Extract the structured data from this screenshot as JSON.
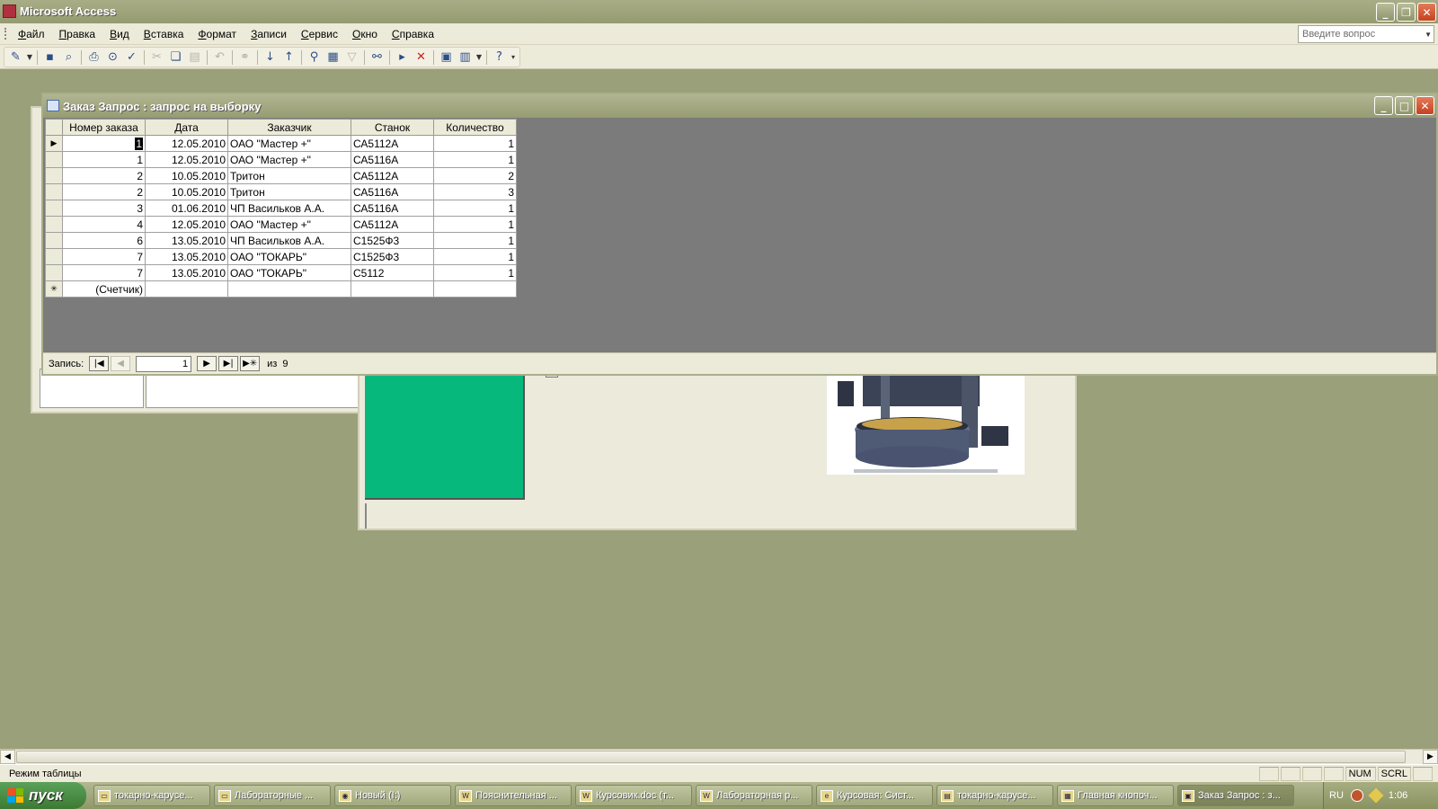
{
  "app": {
    "title": "Microsoft Access"
  },
  "menu": {
    "items": [
      "Файл",
      "Правка",
      "Вид",
      "Вставка",
      "Формат",
      "Записи",
      "Сервис",
      "Окно",
      "Справка"
    ],
    "ask_placeholder": "Введите вопрос"
  },
  "toolbar": {
    "icons": [
      "view-design-icon",
      "dropdown-arrow-icon",
      "save-icon",
      "search-file-icon",
      "print-icon",
      "print-preview-icon",
      "spelling-icon",
      "cut-icon",
      "copy-icon",
      "paste-icon",
      "undo-icon",
      "hyperlink-icon",
      "sort-ascending-icon",
      "sort-descending-icon",
      "filter-by-selection-icon",
      "filter-by-form-icon",
      "apply-filter-icon",
      "find-icon",
      "new-record-icon",
      "delete-record-icon",
      "database-window-icon",
      "new-object-icon",
      "help-icon"
    ]
  },
  "query_window": {
    "title": "Заказ Запрос : запрос на выборку",
    "columns": [
      "Номер заказа",
      "Дата",
      "Заказчик",
      "Станок",
      "Количество"
    ],
    "rows": [
      {
        "order": "1",
        "date": "12.05.2010",
        "customer": "ОАО \"Мастер +\"",
        "machine": "СА5112А",
        "qty": "1"
      },
      {
        "order": "1",
        "date": "12.05.2010",
        "customer": "ОАО \"Мастер +\"",
        "machine": "СА5116А",
        "qty": "1"
      },
      {
        "order": "2",
        "date": "10.05.2010",
        "customer": "Тритон",
        "machine": "СА5112А",
        "qty": "2"
      },
      {
        "order": "2",
        "date": "10.05.2010",
        "customer": "Тритон",
        "machine": "СА5116А",
        "qty": "3"
      },
      {
        "order": "3",
        "date": "01.06.2010",
        "customer": "ЧП Васильков А.А.",
        "machine": "СА5116А",
        "qty": "1"
      },
      {
        "order": "4",
        "date": "12.05.2010",
        "customer": "ОАО \"Мастер +\"",
        "machine": "СА5112А",
        "qty": "1"
      },
      {
        "order": "6",
        "date": "13.05.2010",
        "customer": "ЧП Васильков А.А.",
        "machine": "С1525Ф3",
        "qty": "1"
      },
      {
        "order": "7",
        "date": "13.05.2010",
        "customer": "ОАО \"ТОКАРЬ\"",
        "machine": "С1525Ф3",
        "qty": "1"
      },
      {
        "order": "7",
        "date": "13.05.2010",
        "customer": "ОАО \"ТОКАРЬ\"",
        "machine": "С5112",
        "qty": "1"
      }
    ],
    "new_row_placeholder": "(Счетчик)",
    "navigator": {
      "label": "Запись:",
      "current": "1",
      "of_label": "из",
      "total": "9"
    }
  },
  "statusbar": {
    "mode": "Режим таблицы",
    "num": "NUM",
    "scrl": "SCRL"
  },
  "taskbar": {
    "start_label": "пуск",
    "tasks": [
      {
        "label": "токарно-карусе...",
        "icon": "folder-icon"
      },
      {
        "label": "Лабораторные ...",
        "icon": "folder-icon"
      },
      {
        "label": "Новый (I:)",
        "icon": "drive-icon"
      },
      {
        "label": "Пояснительная ...",
        "icon": "word-icon"
      },
      {
        "label": "Курсовик.doc (т...",
        "icon": "word-icon"
      },
      {
        "label": "Лабораторная р...",
        "icon": "word-icon"
      },
      {
        "label": "Курсовая: Сист...",
        "icon": "ie-icon"
      },
      {
        "label": "токарно-карусе...",
        "icon": "image-icon"
      },
      {
        "label": "Главная кнопоч...",
        "icon": "form-icon"
      },
      {
        "label": "Заказ Запрос : з...",
        "icon": "query-icon"
      }
    ],
    "lang": "RU",
    "clock": "1:06"
  },
  "colors": {
    "desktop": "#9aa07a",
    "form_green": "#06b87b",
    "workspace_gray": "#7b7b7b"
  }
}
